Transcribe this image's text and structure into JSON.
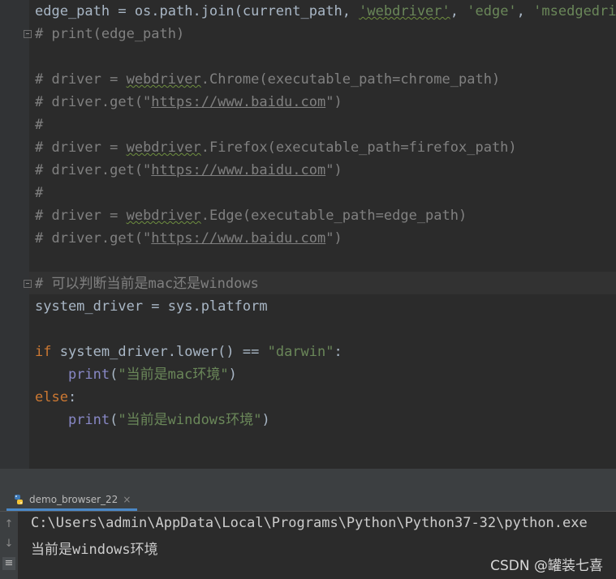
{
  "editor": {
    "lines": [
      {
        "parts": [
          [
            "edge_path = os.path.join(current_path, ",
            "n"
          ],
          [
            "'webdriver'",
            "sw"
          ],
          [
            ", ",
            "n"
          ],
          [
            "'edge'",
            "s"
          ],
          [
            ", ",
            "n"
          ],
          [
            "'msedgedriver.exe'",
            "s"
          ]
        ]
      },
      {
        "parts": [
          [
            "# print(edge_path)",
            "c"
          ]
        ]
      },
      {
        "parts": []
      },
      {
        "parts": [
          [
            "# driver = ",
            "c"
          ],
          [
            "webdriver",
            "cw"
          ],
          [
            ".Chrome(executable_path=chrome_path)",
            "c"
          ]
        ]
      },
      {
        "parts": [
          [
            "# driver.get(\"",
            "c"
          ],
          [
            "https://www.baidu.com",
            "u"
          ],
          [
            "\")",
            "c"
          ]
        ]
      },
      {
        "parts": [
          [
            "#",
            "c"
          ]
        ]
      },
      {
        "parts": [
          [
            "# driver = ",
            "c"
          ],
          [
            "webdriver",
            "cw"
          ],
          [
            ".Firefox(executable_path=firefox_path)",
            "c"
          ]
        ]
      },
      {
        "parts": [
          [
            "# driver.get(\"",
            "c"
          ],
          [
            "https://www.baidu.com",
            "u"
          ],
          [
            "\")",
            "c"
          ]
        ]
      },
      {
        "parts": [
          [
            "#",
            "c"
          ]
        ]
      },
      {
        "parts": [
          [
            "# driver = ",
            "c"
          ],
          [
            "webdriver",
            "cw"
          ],
          [
            ".Edge(executable_path=edge_path)",
            "c"
          ]
        ]
      },
      {
        "parts": [
          [
            "# driver.get(\"",
            "c"
          ],
          [
            "https://www.baidu.com",
            "u"
          ],
          [
            "\")",
            "c"
          ]
        ]
      },
      {
        "parts": []
      },
      {
        "parts": [
          [
            "# 可以判断当前是mac还是windows",
            "c"
          ]
        ]
      },
      {
        "parts": [
          [
            "system_driver = sys.platform",
            "n"
          ]
        ]
      },
      {
        "parts": []
      },
      {
        "parts": [
          [
            "if",
            "k"
          ],
          [
            " system_driver.lower() == ",
            "n"
          ],
          [
            "\"darwin\"",
            "s"
          ],
          [
            ":",
            "n"
          ]
        ]
      },
      {
        "parts": [
          [
            "    ",
            "n"
          ],
          [
            "print",
            "f"
          ],
          [
            "(",
            "n"
          ],
          [
            "\"当前是mac环境\"",
            "s"
          ],
          [
            ")",
            "n"
          ]
        ]
      },
      {
        "parts": [
          [
            "else",
            "k"
          ],
          [
            ":",
            "n"
          ]
        ]
      },
      {
        "parts": [
          [
            "    ",
            "n"
          ],
          [
            "print",
            "f"
          ],
          [
            "(",
            "n"
          ],
          [
            "\"当前是windows环境\"",
            "s"
          ],
          [
            ")",
            "n"
          ]
        ]
      }
    ]
  },
  "run_tab": {
    "label": "demo_browser_22",
    "close": "×"
  },
  "console": {
    "lines": [
      "C:\\Users\\admin\\AppData\\Local\\Programs\\Python\\Python37-32\\python.exe",
      "当前是windows环境"
    ]
  },
  "watermark": "CSDN @罐装七喜",
  "colors": {
    "background": "#2b2b2b",
    "comment": "#808080",
    "string": "#6a8759",
    "keyword": "#cc7832",
    "builtin": "#8888c6",
    "text": "#a9b7c6"
  }
}
